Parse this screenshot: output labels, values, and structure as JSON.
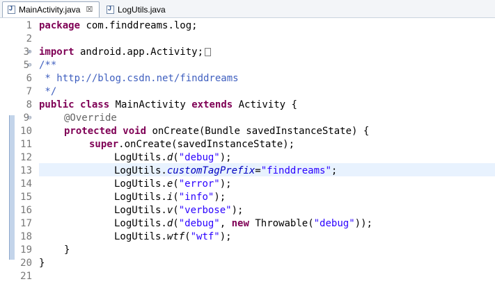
{
  "tabs": [
    {
      "label": "MainActivity.java",
      "close": "☒"
    },
    {
      "label": "LogUtils.java"
    }
  ],
  "gutter": [
    "1",
    "2",
    "3",
    "5",
    "6",
    "7",
    "8",
    "9",
    "10",
    "11",
    "12",
    "13",
    "14",
    "15",
    "16",
    "17",
    "18",
    "19",
    "20",
    "21"
  ],
  "fold_markers": {
    "expand": "⊕",
    "collapse": "⊖"
  },
  "code": {
    "l1": {
      "kw": "package",
      "rest": " com.finddreams.log;"
    },
    "l3": {
      "kw": "import",
      "rest": " android.app.Activity;"
    },
    "l5": "/**",
    "l6": " * http://blog.csdn.net/finddreams",
    "l7": " */",
    "l8": {
      "kw1": "public",
      "kw2": "class",
      "name": " MainActivity ",
      "kw3": "extends",
      "rest": " Activity {"
    },
    "l9": "@Override",
    "l10": {
      "kw1": "protected",
      "kw2": "void",
      "rest": " onCreate(Bundle savedInstanceState) {"
    },
    "l11": {
      "kw": "super",
      "rest": ".onCreate(savedInstanceState);"
    },
    "l12": {
      "pre": "LogUtils.",
      "m": "d",
      "open": "(",
      "s": "\"debug\"",
      "close": ");"
    },
    "l13": {
      "pre": "LogUtils.",
      "field": "customTagPrefix",
      "eq": "=",
      "s": "\"finddreams\"",
      "close": ";"
    },
    "l14": {
      "pre": "LogUtils.",
      "m": "e",
      "open": "(",
      "s": "\"error\"",
      "close": ");"
    },
    "l15": {
      "pre": "LogUtils.",
      "m": "i",
      "open": "(",
      "s": "\"info\"",
      "close": ");"
    },
    "l16": {
      "pre": "LogUtils.",
      "m": "v",
      "open": "(",
      "s": "\"verbose\"",
      "close": ");"
    },
    "l17": {
      "pre": "LogUtils.",
      "m": "d",
      "open": "(",
      "s": "\"debug\"",
      "mid": ", ",
      "kw": "new",
      "mid2": " Throwable(",
      "s2": "\"debug\"",
      "close": "));"
    },
    "l18": {
      "pre": "LogUtils.",
      "m": "wtf",
      "open": "(",
      "s": "\"wtf\"",
      "close": ");"
    },
    "l19": "}",
    "l20": "}"
  },
  "colors": {
    "keyword": "#7f0055",
    "comment": "#3f5fbf",
    "string": "#2a00ff",
    "annotation": "#646464",
    "field": "#0000c0",
    "current_line": "#e8f2fe"
  }
}
